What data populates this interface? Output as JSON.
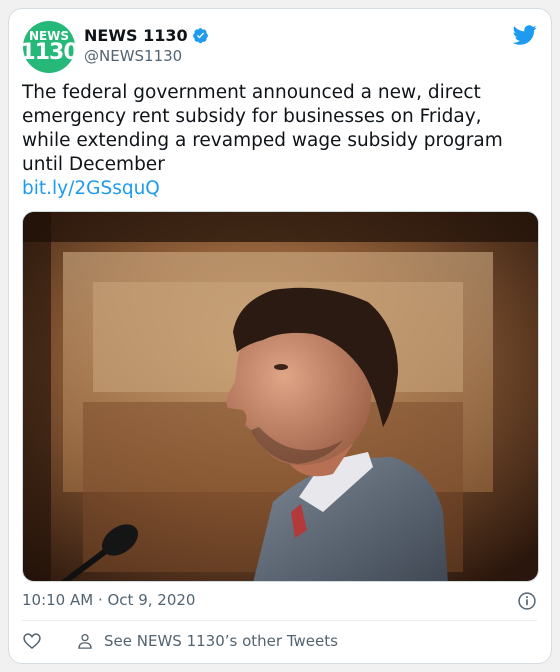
{
  "account": {
    "avatar_line1": "NEWS",
    "avatar_line2": "1130",
    "display_name": "NEWS 1130",
    "handle": "@NEWS1130",
    "verified_icon": "verified-badge-icon",
    "brand_icon": "twitter-bird-icon"
  },
  "tweet": {
    "text": "The federal government announced a new, direct emergency rent subsidy for businesses on Friday, while extending a revamped wage subsidy program until December",
    "link": "bit.ly/2GSsquQ",
    "timestamp": "10:10 AM · Oct 9, 2020"
  },
  "actions": {
    "like_icon": "heart-icon",
    "profile_icon": "person-icon",
    "other_tweets_label": "See NEWS 1130’s other Tweets"
  },
  "colors": {
    "brand_green": "#25b879",
    "link_blue": "#1d9bf0",
    "muted": "#536471"
  }
}
